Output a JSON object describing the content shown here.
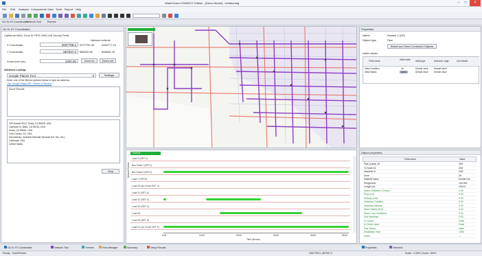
{
  "app": {
    "title": "WaterGems CONNECT Edition - [Demo Model] - Untitled.wtg",
    "menu": [
      "File",
      "Edit",
      "Analysis",
      "Components",
      "View",
      "Tools",
      "Report",
      "Help"
    ],
    "doc_tabs": [
      "Go To XY Coordinates",
      "Network Tool",
      "Themes"
    ]
  },
  "left_panel": {
    "title": "Go To XY Coordinates",
    "coord_header": "California NAD, Zone III FIPS 0403 (US Survey Feet)",
    "x_label": "X Coordinate:",
    "x_value": "2067795.0",
    "y_label": "Y Coordinate:",
    "y_value": "587537.0",
    "network_extents_label": "Network extents",
    "extent_vals": [
      "2077750.45",
      "2063777.23",
      "586320.65",
      "588508.78"
    ],
    "zoom_label": "Zoom level (m):",
    "zoom_value": "1000.00",
    "zoom_btn": "Zoom to",
    "clear_btn": "Zoom out",
    "address_section": "Address Lookup",
    "service_value": "Google Places Tool",
    "settings_btn": "Settings",
    "address_hint": "Enter one of the filtered options below or type an address.",
    "link_text": "Use Google Maps API / Terms of Service",
    "result_selected": "Some Results",
    "result_lines": [
      "325 Russell Rd & Trinity, CA 96028, USA",
      "Lakeside Dr, Bass, CA 95018, USA",
      "Davis, CA 95616, USA",
      "Yolo County, CA, USA",
      "Sacramento, Ambient Estimate (Bounds Est. Dis. Dis.)",
      "California, USA",
      "United States"
    ],
    "go_btn": "Stop"
  },
  "right_panel": {
    "title": "Properties",
    "name_label": "Name",
    "name_value": "Russell 1 (US)",
    "type_label": "Object type",
    "type_value": "Pipe",
    "select_btn": "Select and View Controlled Objects",
    "table_title": "Initial values",
    "table_headers": [
      "Field name",
      "Initial value",
      "Initial type",
      "Unknown origin",
      "Use default"
    ],
    "table_rows": [
      [
        "Initial Condition",
        "On",
        "Default value",
        "Default value"
      ],
      [
        "Initial Status",
        "Open",
        "Default value",
        "Default value"
      ]
    ],
    "props_title": "Object properties",
    "props_headers": [
      "Field name",
      "Value"
    ],
    "props_rows": [
      [
        "Pipe (Label) 15",
        "ZN1"
      ],
      [
        "To Node 16",
        "ZN2"
      ],
      [
        "Diameter 8",
        "ZN3"
      ],
      [
        "Zone",
        "ZA"
      ],
      [
        "Material Name",
        "Ductile Iron"
      ],
      [
        "Roughness",
        "130.000"
      ],
      [
        "Length (m)",
        "125.41"
      ],
      [
        "Hazen Williams C-Factor",
        "1.00"
      ],
      [
        "Flow (L/s)",
        "0.00"
      ],
      [
        "Velocity (m/s)",
        "0.00"
      ],
      [
        "Headloss Gradient",
        "0.00"
      ],
      [
        "Headloss Method",
        "0.00"
      ],
      [
        "Wave Speed (m/s)",
        "0.00"
      ],
      [
        "Minor Loss Coefficient",
        "0.00"
      ],
      [
        "Unit Headloss",
        "0.00"
      ],
      [
        "Is Closed",
        "False"
      ],
      [
        "Is Check Valve",
        "False"
      ],
      [
        "Pipe Status",
        "Open"
      ],
      [
        "Installation Year",
        "1998"
      ],
      [
        "Notes",
        "—"
      ]
    ]
  },
  "timeline": {
    "title": "Timeline",
    "rows": [
      "Load 1 (SET 1)",
      "Bus Fault 1 (SET2)",
      "Bus Fault 2 (SET2)",
      "Load 7 (SET3)",
      "Load 10 (Ac Curve SET 4)",
      "Load 11 (SET 4)",
      "Load 12 (SET 4)",
      "Load 13 (SET 4)",
      "Load 19",
      "Load 20 (SET 5)",
      "Load 21 (Ac Curve SET 5)"
    ],
    "axis_ticks": [
      "0:00",
      "10:00",
      "20:00",
      "30:00",
      "40:00",
      "50:00"
    ],
    "axis_label": "Time (hh:mm)",
    "y_label": "Network Events"
  },
  "bottom_tabs": [
    "Go To XY Coordinates",
    "Network Tool",
    "Themes",
    "Row Manager",
    "Summary",
    "Setup Results"
  ],
  "right_bottom_tabs": [
    "Properties",
    "Selection"
  ],
  "status": {
    "left": "Ready - Tools/Pointer",
    "mid": "2067795.0, 587537.0",
    "right": "Scale: 1:1000 | Zoom: 100%"
  },
  "colors": {
    "accent": "#2c6fb5",
    "pipe": "#8b3cc2",
    "road_red": "#e66a5a",
    "timeline_bar": "#35d135",
    "map_tag": "#1fae3a"
  }
}
